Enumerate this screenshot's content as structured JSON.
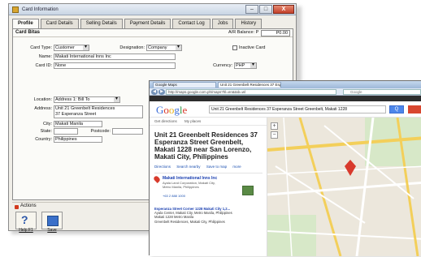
{
  "card_window": {
    "title": "Card Information",
    "tabs": [
      "Profile",
      "Card Details",
      "Selling Details",
      "Payment Details",
      "Contact Log",
      "Jobs",
      "History"
    ],
    "section": "Card Bitas",
    "ar_balance_label": "A/R Balance: P",
    "ar_balance_value": "P0.00",
    "fields": {
      "card_type_label": "Card Type:",
      "card_type_value": "Customer",
      "designation_label": "Designation:",
      "designation_value": "Company",
      "inactive_label": "Inactive Card",
      "name_label": "Name:",
      "name_value": "Makati International Inns Inc",
      "card_id_label": "Card ID:",
      "card_id_value": "None",
      "currency_label": "Currency:",
      "currency_value": "PHP",
      "location_label": "Location:",
      "location_value": "Address 1: Bill To",
      "address_label": "Address:",
      "address_line1": "Unit 21 Greenbelt Residences",
      "address_line2": "37 Esperanza Street",
      "city_label": "City:",
      "city_value": "Makati Manila",
      "state_label": "State:",
      "postcode_label": "Postcode:",
      "country_label": "Country:",
      "country_value": "Philippines"
    },
    "actions_label": "Actions",
    "toolbar": {
      "help_label": "Help F1",
      "save_label": "Save"
    },
    "window_buttons": {
      "minimize": "–",
      "maximize": "□",
      "close": "X"
    }
  },
  "browser": {
    "tabs": [
      "Google Maps",
      "Unit 21 Greenbelt Residences 37 Espe..."
    ],
    "url": "http://maps.google.com.ph/maps?hl=en&tab=wl",
    "search_placeholder": "Google",
    "query": "Unit 21 Greenbelt Residences 37 Esperanza Street Greenbelt, Makati 1228",
    "search_button": "Q",
    "pane_tools": [
      "Get directions",
      "My places"
    ],
    "result": {
      "title_lines": [
        "Unit 21 Greenbelt Residences 37",
        "Esperanza Street Greenbelt,",
        "Makati 1228 near San Lorenzo,",
        "Makati City, Philippines"
      ],
      "links": [
        "Directions",
        "Search nearby",
        "Save to map",
        "more"
      ],
      "place_title": "Makati International Inns Inc",
      "place_desc": [
        "Ayala Land Corporation, Makati City,",
        "Metro Manila, Philippines"
      ],
      "place_phone": "+63 2 888 1000",
      "second_lines": [
        "Esperanza Street Corner 1228 Makati City 1,2...",
        "Ayala Center, Makati City, Metro Manila, Philippines",
        "Makati 1228 Metro Manila",
        "Greenbelt Residences, Makati City, Philippines"
      ]
    },
    "map_controls": [
      "+",
      "−"
    ]
  }
}
